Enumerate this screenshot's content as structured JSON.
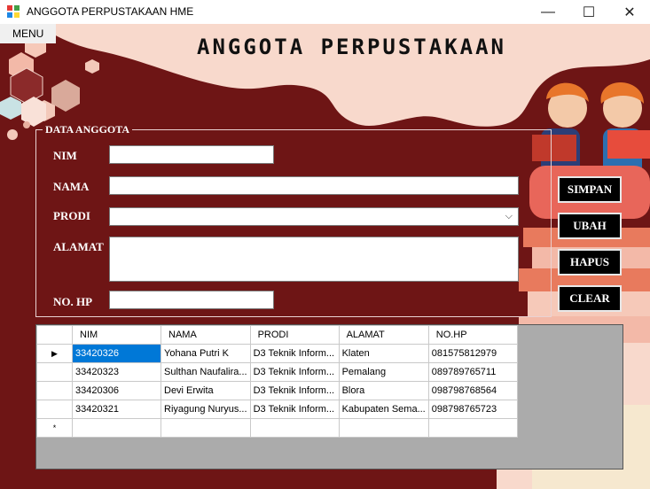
{
  "window": {
    "title": "ANGGOTA PERPUSTAKAAN HME",
    "minimize_glyph": "—",
    "maximize_glyph": "☐",
    "close_glyph": "✕"
  },
  "menu": {
    "label": "MENU"
  },
  "heading": "ANGGOTA PERPUSTAKAAN",
  "form": {
    "group_title": "DATA ANGGOTA",
    "nim_label": "NIM",
    "nama_label": "NAMA",
    "prodi_label": "PRODI",
    "alamat_label": "ALAMAT",
    "nohp_label": "NO. HP",
    "nim_value": "",
    "nama_value": "",
    "prodi_value": "",
    "alamat_value": "",
    "nohp_value": ""
  },
  "buttons": {
    "simpan": "SIMPAN",
    "ubah": "UBAH",
    "hapus": "HAPUS",
    "clear": "CLEAR"
  },
  "table": {
    "columns": [
      "NIM",
      "NAMA",
      "PRODI",
      "ALAMAT",
      "NO.HP"
    ],
    "rows": [
      [
        "33420326",
        "Yohana Putri K",
        "D3 Teknik Inform...",
        "Klaten",
        "081575812979"
      ],
      [
        "33420323",
        "Sulthan Naufalira...",
        "D3 Teknik Inform...",
        "Pemalang",
        "089789765711"
      ],
      [
        "33420306",
        "Devi Erwita",
        "D3 Teknik Inform...",
        "Blora",
        "098798768564"
      ],
      [
        "33420321",
        "Riyagung Nuryus...",
        "D3 Teknik Inform...",
        "Kabupaten Sema...",
        "098798765723"
      ]
    ],
    "current_row_glyph": "▶",
    "new_row_glyph": "*"
  },
  "colors": {
    "background": "#6e1515",
    "selection": "#0078d7"
  }
}
